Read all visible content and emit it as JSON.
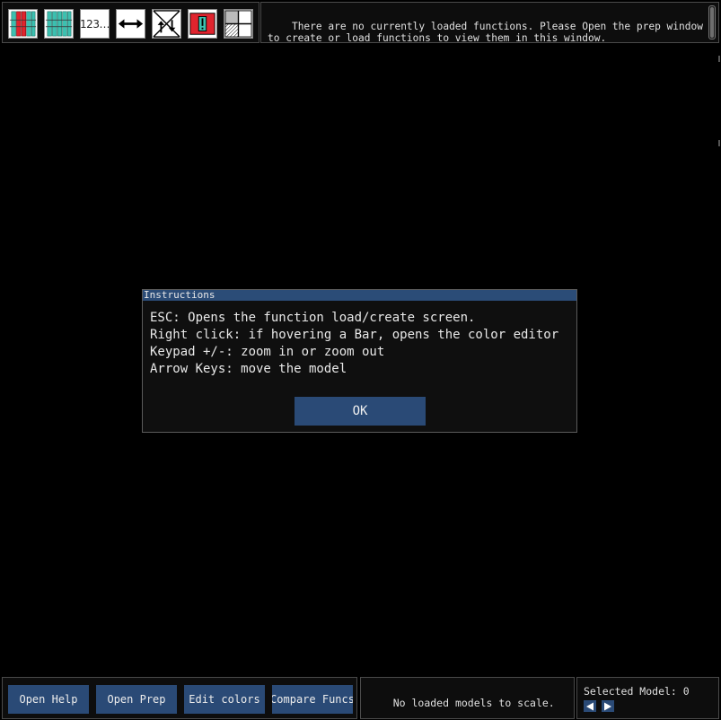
{
  "toolbar": {
    "tools": [
      {
        "icon": "bars-red-icon",
        "tooltip": ""
      },
      {
        "icon": "bars-teal-icon",
        "tooltip": ""
      },
      {
        "icon": "numbers-icon",
        "text": "123…"
      },
      {
        "icon": "double-arrow-horizontal-icon"
      },
      {
        "icon": "swap-vertical-icon"
      },
      {
        "icon": "alert-red-icon"
      },
      {
        "icon": "grid-quadrant-icon"
      }
    ]
  },
  "message": {
    "text": "There are no currently loaded functions. Please Open the prep window\nto create or load functions to view them in this window."
  },
  "dialog": {
    "title": "Instructions",
    "lines": [
      "ESC: Opens the function load/create screen.",
      "Right click: if hovering a Bar, opens the color editor",
      "Keypad +/-: zoom in or zoom out",
      "Arrow Keys: move the model"
    ],
    "ok_label": "OK"
  },
  "bottom": {
    "buttons": [
      "Open Help",
      "Open Prep",
      "Edit colors",
      "Compare Funcs"
    ],
    "scale_status": "No loaded models to scale.",
    "selected_model_label": "Selected Model: 0"
  },
  "colors": {
    "accent": "#2a4a76",
    "title_bar": "#2b4c77",
    "background": "#000000",
    "panel": "#0d0d0d",
    "teal": "#3cc0b0",
    "red": "#e0242e"
  }
}
